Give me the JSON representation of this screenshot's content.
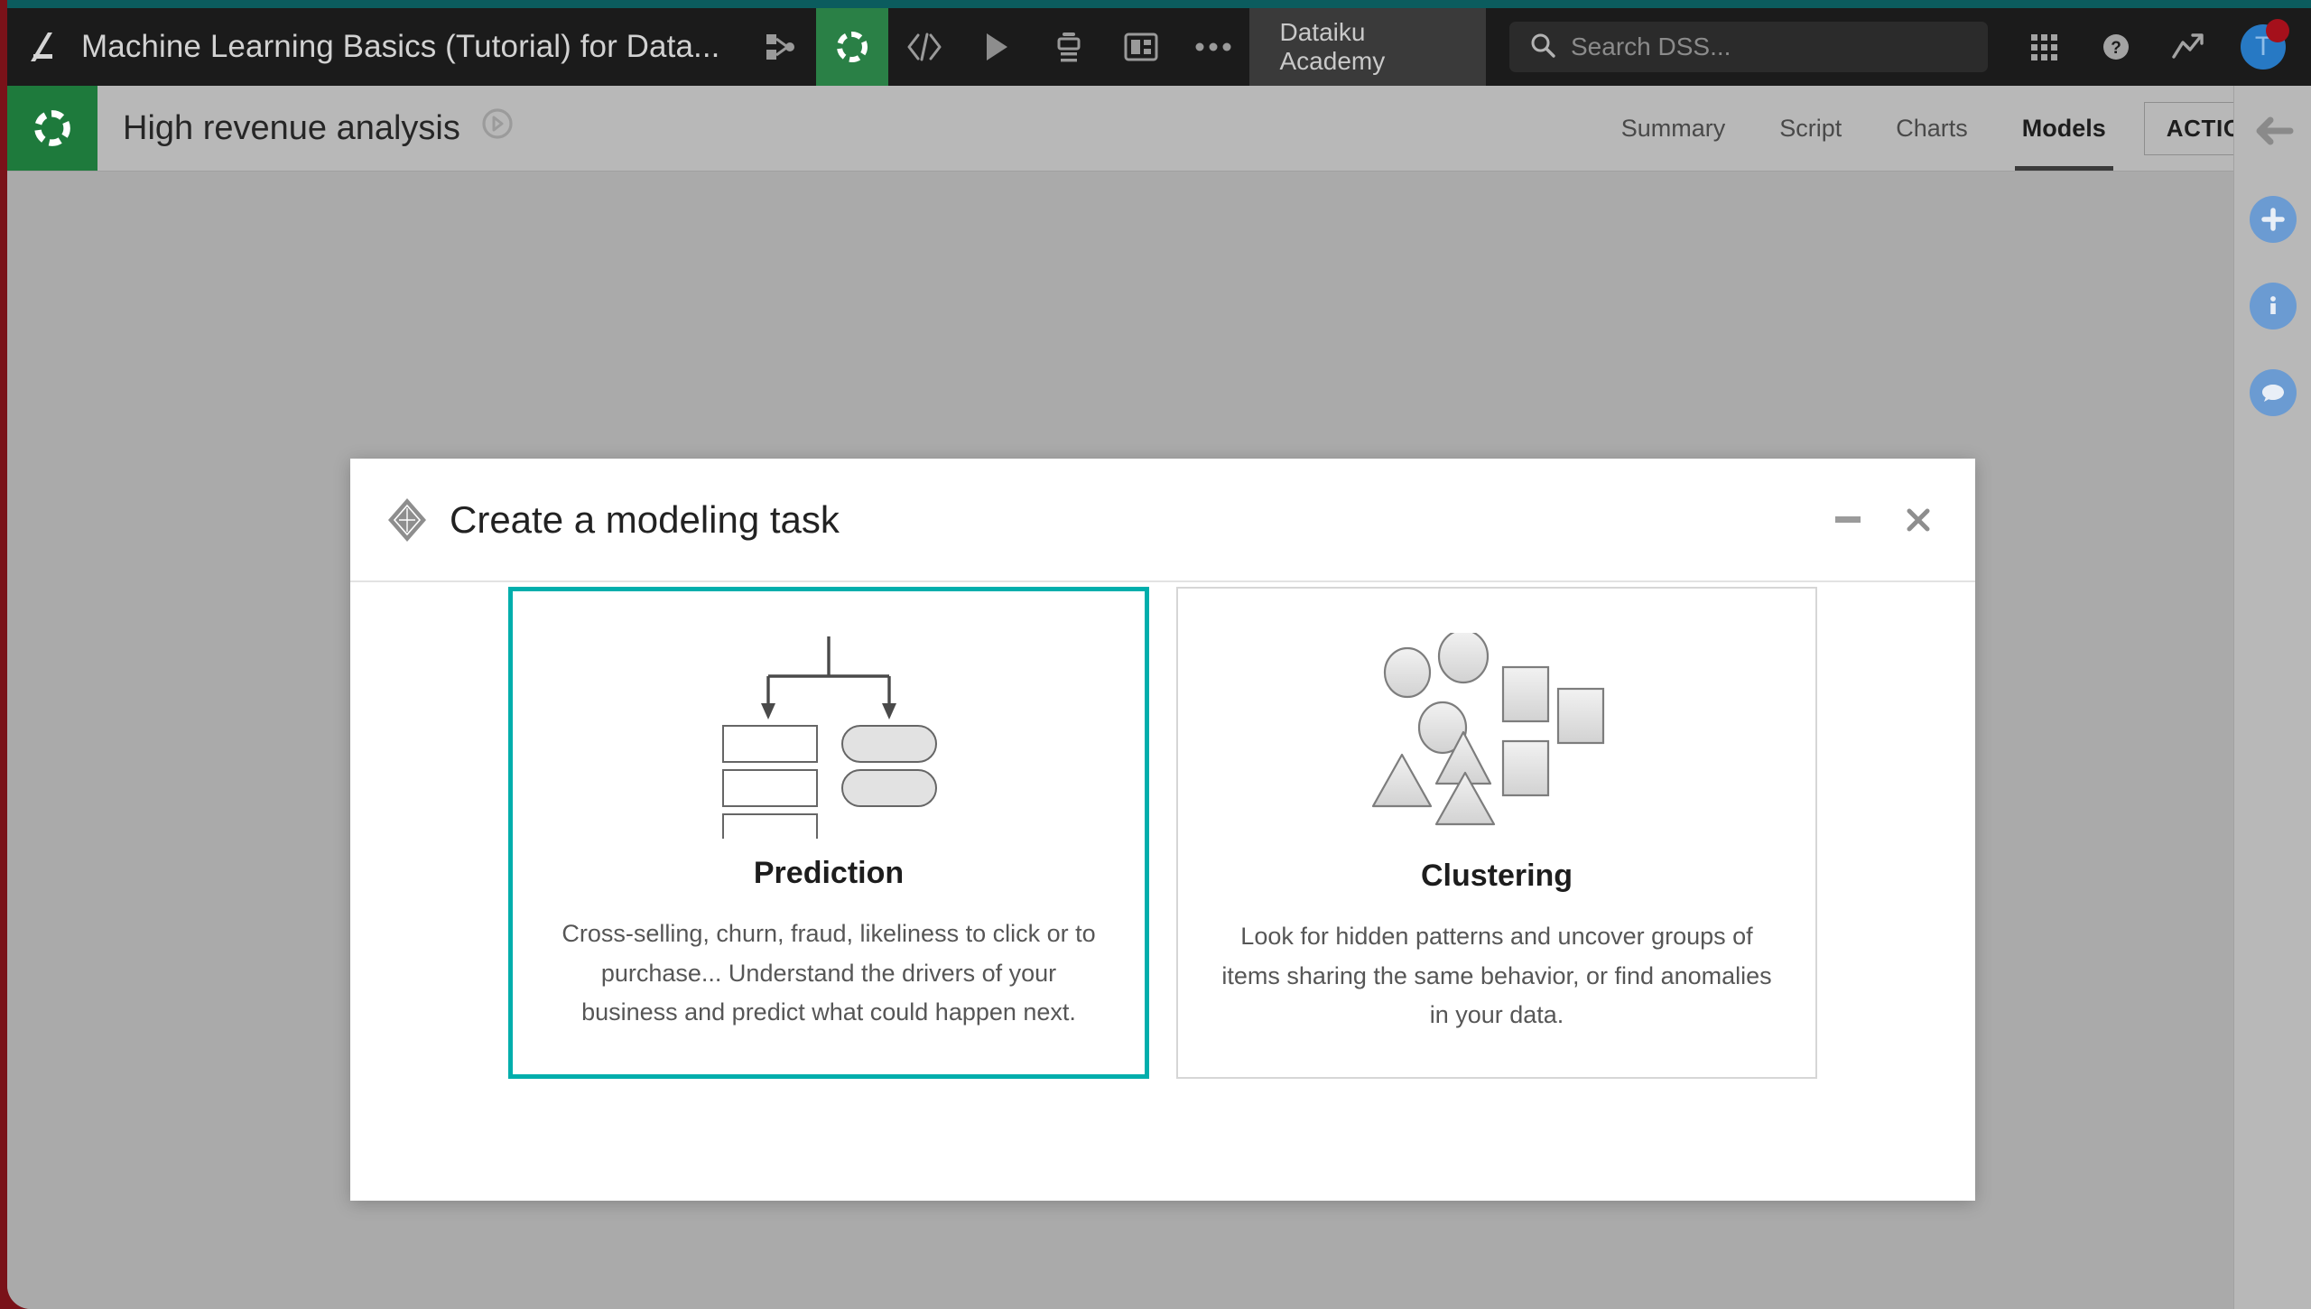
{
  "theme": {
    "accent_teal": "#0b5c5e",
    "selection_teal": "#00aeac",
    "navbar_bg": "#1b1b1b",
    "subheader_bg": "#b8b8b8",
    "lab_green": "#2a8046",
    "project_green": "#1e7a3c",
    "avatar_blue": "#2779c4",
    "badge_red": "#a5101b",
    "rail_blue": "#6b9bd2",
    "page_bg": "#aaaaaa"
  },
  "navbar": {
    "home_icon": "dataiku-logo-icon",
    "project_title": "Machine Learning Basics (Tutorial) for Data...",
    "icons": [
      {
        "name": "flow-icon",
        "active": false
      },
      {
        "name": "lab-icon",
        "active": true
      },
      {
        "name": "code-icon",
        "active": false
      },
      {
        "name": "jobs-play-icon",
        "active": false
      },
      {
        "name": "recipes-icon",
        "active": false
      },
      {
        "name": "dashboards-icon",
        "active": false
      },
      {
        "name": "more-ellipsis-icon",
        "active": false
      }
    ],
    "workspace_label": "Dataiku Academy",
    "search": {
      "placeholder": "Search DSS...",
      "value": "",
      "icon": "search-icon"
    },
    "apps_icon": "apps-grid-icon",
    "help_icon": "help-question-icon",
    "activity_icon": "trend-up-icon",
    "avatar": {
      "initial": "T",
      "icon": "avatar",
      "badge": true
    }
  },
  "subheader": {
    "logo_icon": "project-logo-icon",
    "title": "High revenue analysis",
    "badge_icon": "analysis-compass-icon",
    "tabs": [
      {
        "label": "Summary",
        "active": false
      },
      {
        "label": "Script",
        "active": false
      },
      {
        "label": "Charts",
        "active": false
      },
      {
        "label": "Models",
        "active": true
      }
    ],
    "actions_label": "ACTIONS"
  },
  "right_rail": {
    "items": [
      {
        "name": "collapse-panel-arrow-icon",
        "style": "plain"
      },
      {
        "name": "add-plus-icon",
        "style": "circle"
      },
      {
        "name": "info-icon",
        "style": "circle"
      },
      {
        "name": "comments-chat-icon",
        "style": "circle"
      }
    ]
  },
  "modal": {
    "icon": "modeling-task-diamond-icon",
    "title": "Create a modeling task",
    "minimize_label": "",
    "close_label": "✕",
    "cards": [
      {
        "id": "prediction",
        "art": "decision-tree-icon",
        "title": "Prediction",
        "description": "Cross-selling, churn, fraud, likeliness to click or to purchase... Understand the drivers of your business and predict what could happen next.",
        "selected": true
      },
      {
        "id": "clustering",
        "art": "clusters-shapes-icon",
        "title": "Clustering",
        "description": "Look for hidden patterns and uncover groups of items sharing the same behavior, or find anomalies in your data.",
        "selected": false
      }
    ]
  }
}
